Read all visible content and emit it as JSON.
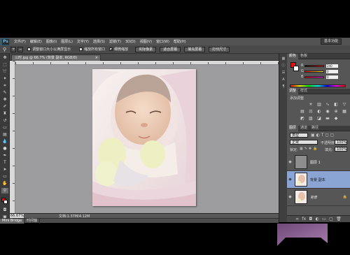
{
  "app": {
    "logo": "Ps"
  },
  "menu": [
    "文件(F)",
    "编辑(E)",
    "图像(I)",
    "图层(L)",
    "文字(Y)",
    "选择(S)",
    "滤镜(T)",
    "3D(D)",
    "视图(V)",
    "窗口(W)",
    "帮助(H)"
  ],
  "workspace": "基本功能",
  "options": {
    "checks": [
      {
        "label": "调整窗口大小以满屏显示",
        "checked": false
      },
      {
        "label": "缩放所有窗口",
        "checked": false
      },
      {
        "label": "细微缩放",
        "checked": true
      }
    ],
    "buttons": [
      "实际像素",
      "适合屏幕",
      "填充屏幕",
      "打印尺寸"
    ]
  },
  "document": {
    "tab_title": "三时.jpg @ 66.7% (背景 副本, RGB/8)",
    "close": "×"
  },
  "status": {
    "zoom": "66.67%",
    "doc_info": "文档:1.37M/4.12M"
  },
  "mini_bridge": {
    "tabs": [
      "Mini Bridge",
      "时间轴"
    ]
  },
  "color_panel": {
    "tabs": [
      "颜色",
      "色板"
    ],
    "fg_color": "#e81010",
    "bg_color": "#ffffff",
    "sliders": [
      {
        "label": "R",
        "value": "240"
      },
      {
        "label": "G",
        "value": "0"
      },
      {
        "label": "B",
        "value": "0"
      }
    ]
  },
  "adjust_panel": {
    "tabs": [
      "调整",
      "样式"
    ],
    "title": "添加调整"
  },
  "layers_panel": {
    "tabs": [
      "图层",
      "通道",
      "路径"
    ],
    "kind": "类型",
    "blend_mode": "正常",
    "opacity_label": "不透明度:",
    "opacity": "100%",
    "lock_label": "锁定:",
    "fill_label": "填充:",
    "fill": "100%",
    "layers": [
      {
        "name": "图层 1",
        "selected": false
      },
      {
        "name": "背景 副本",
        "selected": true
      },
      {
        "name": "背景",
        "selected": false
      }
    ]
  },
  "colors": {
    "accent": "#8aa4d4",
    "canvas": "#9d9c9f",
    "chrome": "#535353"
  }
}
